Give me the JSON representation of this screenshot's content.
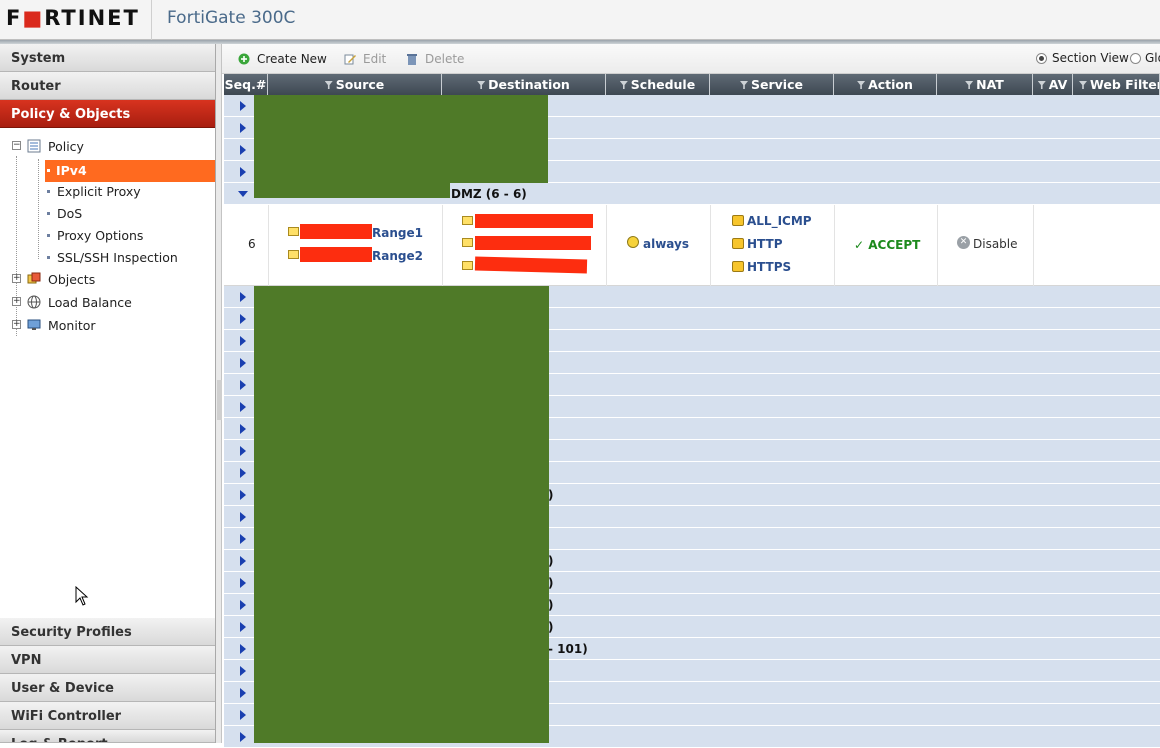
{
  "header": {
    "logo_prefix": "F",
    "logo_mid": "■",
    "logo_suffix": "RTINET",
    "product": "FortiGate 300C"
  },
  "sidebar": {
    "top_sections": [
      "System",
      "Router",
      "Policy & Objects"
    ],
    "tree": {
      "policy": "Policy",
      "ipv4": "IPv4",
      "explicit_proxy": "Explicit Proxy",
      "dos": "DoS",
      "proxy_options": "Proxy Options",
      "ssl_ssh": "SSL/SSH Inspection",
      "objects": "Objects",
      "load_balance": "Load Balance",
      "monitor": "Monitor"
    },
    "bottom_sections": [
      "Security Profiles",
      "VPN",
      "User & Device",
      "WiFi Controller",
      "Log & Report"
    ]
  },
  "toolbar": {
    "create_new": "Create New",
    "edit": "Edit",
    "delete": "Delete",
    "section_view": "Section View",
    "global_view": "Glo"
  },
  "table": {
    "headers": [
      "Seq.#",
      "Source",
      "Destination",
      "Schedule",
      "Service",
      "Action",
      "NAT",
      "AV",
      "Web Filter"
    ],
    "expanded_section_label": "DMZ (6 - 6)",
    "row": {
      "seq": "6",
      "source": [
        "Range1",
        "Range2"
      ],
      "schedule": "always",
      "services": [
        "ALL_ICMP",
        "HTTP",
        "HTTPS"
      ],
      "action": "ACCEPT",
      "nat": "Disable"
    },
    "partial_labels": {
      "r9": ")",
      "r12": ")",
      "r13": ")",
      "r14": ")",
      "r15": ")",
      "r16": "- 101)"
    }
  }
}
